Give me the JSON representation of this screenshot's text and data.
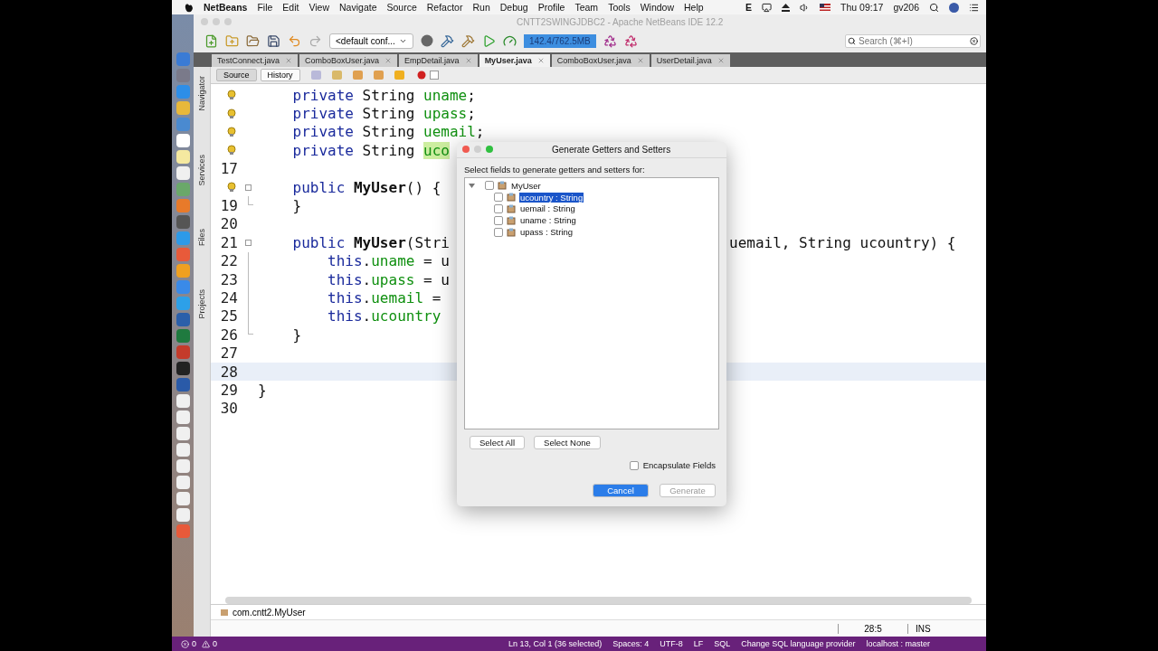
{
  "menubar": {
    "app": "NetBeans",
    "menus": [
      "File",
      "Edit",
      "View",
      "Navigate",
      "Source",
      "Refactor",
      "Run",
      "Debug",
      "Profile",
      "Team",
      "Tools",
      "Window",
      "Help"
    ],
    "input": "E",
    "clock": "Thu 09:17",
    "user": "gv206"
  },
  "window": {
    "title": "CNTT2SWINGJDBC2 - Apache NetBeans IDE 12.2"
  },
  "toolbar": {
    "config": "<default conf...",
    "memory": "142.4/762.5MB",
    "search": {
      "placeholder": "Search (⌘+I)"
    }
  },
  "tabs": [
    {
      "label": "TestConnect.java",
      "selected": false
    },
    {
      "label": "ComboBoxUser.java",
      "selected": false
    },
    {
      "label": "EmpDetail.java",
      "selected": false
    },
    {
      "label": "MyUser.java",
      "selected": true
    },
    {
      "label": "ComboBoxUser.java",
      "selected": false
    },
    {
      "label": "UserDetail.java",
      "selected": false
    }
  ],
  "editor_tabs": [
    {
      "label": "Source",
      "selected": true
    },
    {
      "label": "History",
      "selected": false
    }
  ],
  "side_panels": [
    "Navigator",
    "Services",
    "Files",
    "Projects"
  ],
  "code": [
    {
      "hint": true,
      "tokens": [
        {
          "text": "    private",
          "kind": "keyword"
        },
        {
          "text": " String "
        },
        {
          "text": "uname",
          "kind": "field"
        },
        {
          "text": ";"
        }
      ]
    },
    {
      "hint": true,
      "tokens": [
        {
          "text": "    private",
          "kind": "keyword"
        },
        {
          "text": " String "
        },
        {
          "text": "upass",
          "kind": "field"
        },
        {
          "text": ";"
        }
      ]
    },
    {
      "hint": true,
      "tokens": [
        {
          "text": "    private",
          "kind": "keyword"
        },
        {
          "text": " String "
        },
        {
          "text": "uemail",
          "kind": "field"
        },
        {
          "text": ";"
        }
      ]
    },
    {
      "hint": true,
      "tokens": [
        {
          "text": "    private",
          "kind": "keyword"
        },
        {
          "text": " String "
        },
        {
          "text": "uco",
          "kind": "marked"
        }
      ]
    },
    {
      "number": "17"
    },
    {
      "hint": true,
      "fold_start": true,
      "tokens": [
        {
          "text": "    public ",
          "kind": "keyword"
        },
        {
          "text": "MyUser",
          "kind": "bold"
        },
        {
          "text": "() {"
        }
      ]
    },
    {
      "number": "19",
      "fold_end": true,
      "tokens": [
        {
          "text": "    }"
        }
      ]
    },
    {
      "number": "20"
    },
    {
      "number": "21",
      "fold_start": true,
      "tokens": [
        {
          "text": "    public ",
          "kind": "keyword"
        },
        {
          "text": "MyUser",
          "kind": "bold"
        },
        {
          "text": "(Stri"
        }
      ],
      "after": "uemail, String ucountry) {"
    },
    {
      "number": "22",
      "fold_body": true,
      "tokens": [
        {
          "text": "        this",
          "kind": "keyword"
        },
        {
          "text": "."
        },
        {
          "text": "uname",
          "kind": "field"
        },
        {
          "text": " = u"
        }
      ]
    },
    {
      "number": "23",
      "fold_body": true,
      "tokens": [
        {
          "text": "        this",
          "kind": "keyword"
        },
        {
          "text": "."
        },
        {
          "text": "upass",
          "kind": "field"
        },
        {
          "text": " = u"
        }
      ]
    },
    {
      "number": "24",
      "fold_body": true,
      "tokens": [
        {
          "text": "        this",
          "kind": "keyword"
        },
        {
          "text": "."
        },
        {
          "text": "uemail",
          "kind": "field"
        },
        {
          "text": " ="
        }
      ]
    },
    {
      "number": "25",
      "fold_body": true,
      "tokens": [
        {
          "text": "        this",
          "kind": "keyword"
        },
        {
          "text": "."
        },
        {
          "text": "ucountry",
          "kind": "field"
        }
      ]
    },
    {
      "number": "26",
      "fold_end": true,
      "tokens": [
        {
          "text": "    }"
        }
      ]
    },
    {
      "number": "27"
    },
    {
      "number": "28",
      "current": true
    },
    {
      "number": "29",
      "tokens": [
        {
          "text": "}"
        }
      ]
    },
    {
      "number": "30"
    }
  ],
  "breadcrumb": "com.cntt2.MyUser",
  "status": {
    "position": "28:5",
    "mode": "INS"
  },
  "vscode_status": {
    "errors": "0",
    "warnings": "0",
    "items": [
      "Ln 13, Col 1 (36 selected)",
      "Spaces: 4",
      "UTF-8",
      "LF",
      "SQL",
      "Change SQL language provider",
      "localhost : master"
    ]
  },
  "dialog": {
    "title": "Generate Getters and Setters",
    "prompt": "Select fields to generate getters and setters for:",
    "tree": {
      "label": "MyUser",
      "checked": false,
      "expanded": true,
      "children": [
        {
          "label": "ucountry : String",
          "checked": false,
          "selected": true
        },
        {
          "label": "uemail : String",
          "checked": false,
          "selected": false
        },
        {
          "label": "uname : String",
          "checked": false,
          "selected": false
        },
        {
          "label": "upass : String",
          "checked": false,
          "selected": false
        }
      ]
    },
    "buttons": [
      "Select All",
      "Select None"
    ],
    "encapsulate": {
      "label": "Encapsulate Fields",
      "checked": false
    },
    "actions": [
      {
        "label": "Cancel",
        "default": true,
        "disabled": false
      },
      {
        "label": "Generate",
        "default": false,
        "disabled": true
      }
    ]
  }
}
